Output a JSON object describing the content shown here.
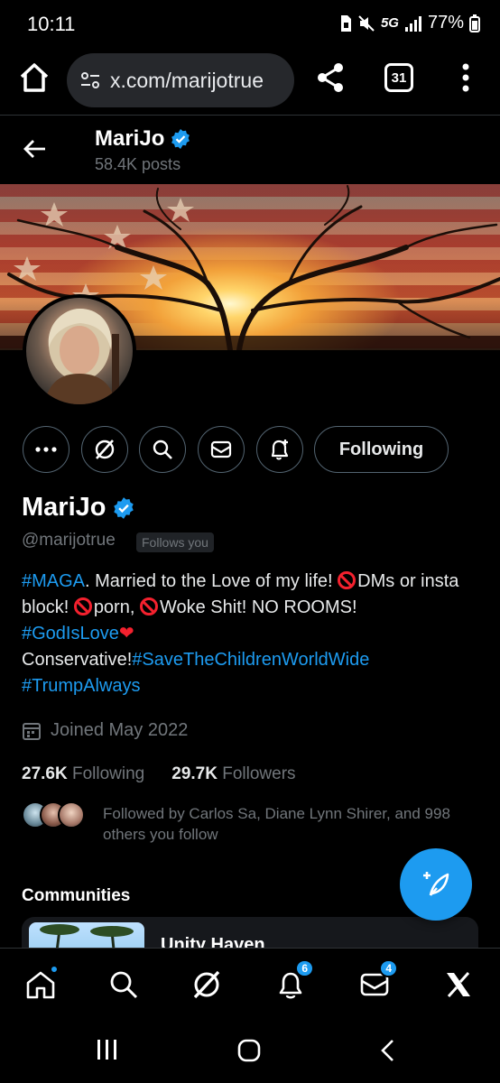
{
  "status_bar": {
    "time": "10:11",
    "network": "5G",
    "battery": "77%"
  },
  "browser": {
    "url": "x.com/marijotrue",
    "tab_count": "31"
  },
  "header": {
    "name": "MariJo",
    "posts": "58.4K posts"
  },
  "actions": {
    "following_label": "Following"
  },
  "profile": {
    "display_name": "MariJo",
    "handle": "@marijotrue",
    "follows_you": "Follows you",
    "bio": {
      "tag_maga": "#MAGA",
      "text_1": ". Married to the Love of my life! ",
      "text_2": "DMs or insta block! ",
      "text_3": "porn, ",
      "text_4": "Woke Shit! NO ROOMS!",
      "tag_godislove": "#GodIsLove",
      "heart": "❤",
      "text_5": "Conservative!",
      "tag_savechildren": "#SaveTheChildrenWorldWide",
      "tag_trump": "#TrumpAlways"
    },
    "joined": "Joined May 2022",
    "following_count": "27.6K",
    "following_label": "Following",
    "followers_count": "29.7K",
    "followers_label": "Followers",
    "followed_by": "Followed by Carlos Sa, Diane Lynn Shirer, and 998 others you follow"
  },
  "communities": {
    "title": "Communities",
    "first_name": "Unity Haven"
  },
  "bottom_nav": {
    "notifications_badge": "6",
    "messages_badge": "4"
  },
  "colors": {
    "accent": "#1d9bf0",
    "background": "#000000",
    "muted": "#71767b",
    "danger": "#f4212e"
  }
}
